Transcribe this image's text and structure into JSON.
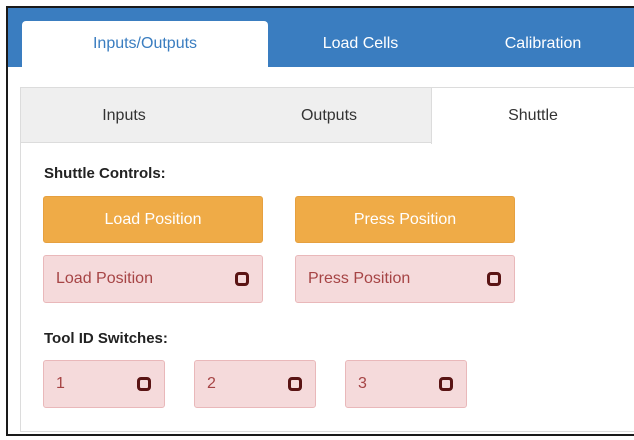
{
  "top_tabs": [
    {
      "label": "Inputs/Outputs",
      "active": true
    },
    {
      "label": "Load Cells",
      "active": false
    },
    {
      "label": "Calibration",
      "active": false
    }
  ],
  "sub_tabs": [
    {
      "label": "Inputs",
      "active": false
    },
    {
      "label": "Outputs",
      "active": false
    },
    {
      "label": "Shuttle",
      "active": true
    }
  ],
  "shuttle": {
    "title": "Shuttle Controls:",
    "load_button": "Load Position",
    "press_button": "Press Position",
    "load_indicator": {
      "label": "Load Position",
      "icon": "square-indicator-icon"
    },
    "press_indicator": {
      "label": "Press Position",
      "icon": "square-indicator-icon"
    }
  },
  "tool_id": {
    "title": "Tool ID Switches:",
    "switches": [
      {
        "label": "1",
        "icon": "square-indicator-icon"
      },
      {
        "label": "2",
        "icon": "square-indicator-icon"
      },
      {
        "label": "3",
        "icon": "square-indicator-icon"
      }
    ]
  },
  "colors": {
    "tab_bar": "#3a7dc0",
    "button": "#efab47",
    "indicator_bg": "#f5dadb",
    "indicator_text": "#a64445"
  }
}
